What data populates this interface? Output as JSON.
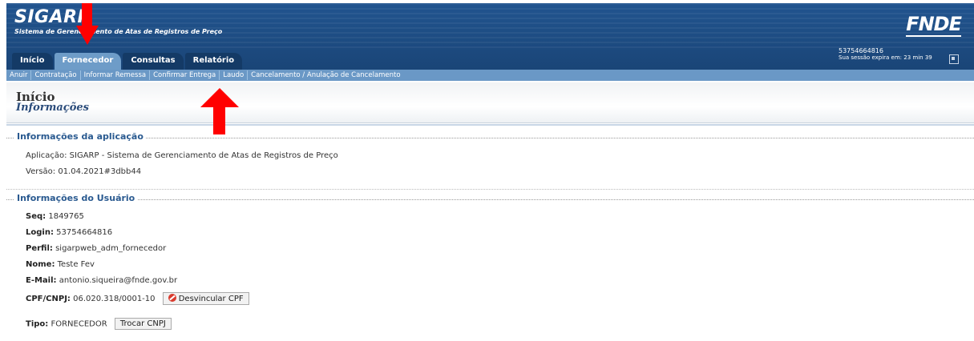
{
  "header": {
    "app_name": "SIGARP",
    "app_subtitle": "Sistema de Gerenciamento de Atas de Registros de Preço",
    "org_logo": "FNDE",
    "user_id": "53754664816",
    "session_text": "Sua sessão expira em: 23 min 39",
    "logout_icon": "logout-icon"
  },
  "tabs": [
    {
      "label": "Início"
    },
    {
      "label": "Fornecedor"
    },
    {
      "label": "Consultas"
    },
    {
      "label": "Relatório"
    }
  ],
  "submenu": [
    {
      "label": "Anuir"
    },
    {
      "label": "Contratação"
    },
    {
      "label": "Informar Remessa"
    },
    {
      "label": "Confirmar Entrega"
    },
    {
      "label": "Laudo"
    },
    {
      "label": "Cancelamento / Anulação de Cancelamento"
    }
  ],
  "page": {
    "title": "Início",
    "subtitle": "Informações"
  },
  "app_info": {
    "legend": "Informações da aplicação",
    "aplicacao": "Aplicação: SIGARP - Sistema de Gerenciamento de Atas de Registros de Preço",
    "versao": "Versão: 01.04.2021#3dbb44"
  },
  "user_info": {
    "legend": "Informações do Usuário",
    "seq_label": "Seq:",
    "seq_value": "1849765",
    "login_label": "Login:",
    "login_value": "53754664816",
    "perfil_label": "Perfil:",
    "perfil_value": "sigarpweb_adm_fornecedor",
    "nome_label": "Nome:",
    "nome_value": "Teste Fev",
    "email_label": "E-Mail:",
    "email_value": "antonio.siqueira@fnde.gov.br",
    "cpf_label": "CPF/CNPJ:",
    "cpf_value": "06.020.318/0001-10",
    "desvincular_button": "Desvincular CPF",
    "tipo_label": "Tipo:",
    "tipo_value": "FORNECEDOR",
    "trocar_button": "Trocar CNPJ"
  },
  "colors": {
    "header_bg": "#1f4f86",
    "menu_bg": "#6a98c6",
    "active_tab": "#6e9cc8",
    "legend_text": "#2a5a90",
    "annotation_arrow": "#ff0000"
  }
}
